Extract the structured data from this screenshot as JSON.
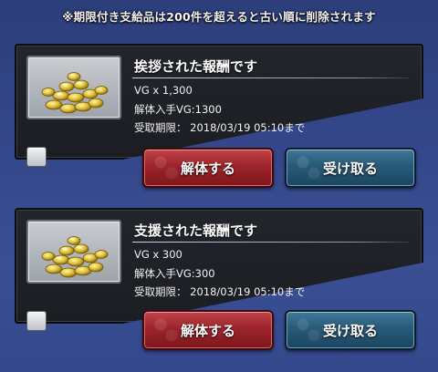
{
  "notice": "※期限付き支給品は200件を超えると古い順に削除されます",
  "colors": {
    "disassemble": "#9c242b",
    "receive": "#285a78",
    "panel": "#1e2026"
  },
  "items": [
    {
      "icon": "gold-coins-icon",
      "title": "挨拶された報酬です",
      "amount": "VG x 1,300",
      "dismantle_value": "解体入手VG:1300",
      "deadline": "受取期限： 2018/03/19 05:10まで",
      "disassemble_label": "解体する",
      "receive_label": "受け取る"
    },
    {
      "icon": "gold-coins-icon",
      "title": "支援された報酬です",
      "amount": "VG x 300",
      "dismantle_value": "解体入手VG:300",
      "deadline": "受取期限： 2018/03/19 05:10まで",
      "disassemble_label": "解体する",
      "receive_label": "受け取る"
    }
  ]
}
